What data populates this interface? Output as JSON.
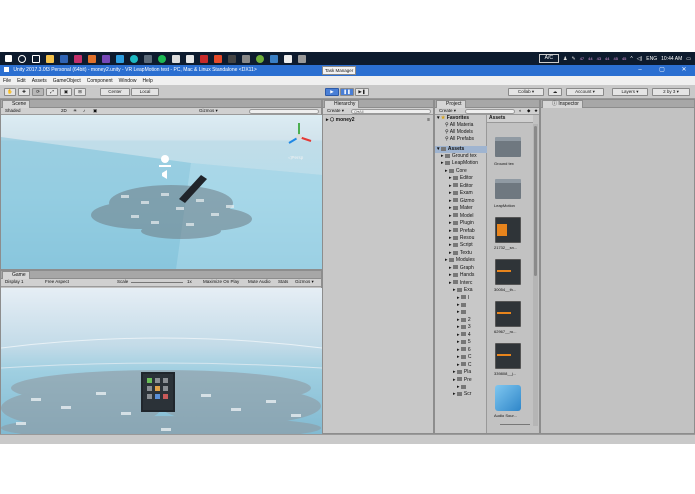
{
  "taskbar": {
    "tooltip": "Task Manager",
    "ac_label": "A/C",
    "tray_numbers": [
      "47",
      "44",
      "43",
      "44",
      "45",
      "45"
    ],
    "language": "ENG",
    "time": "10:44 AM"
  },
  "window": {
    "title": "Unity 2017.3.0f3 Personal (64bit) - money2.unity - VR LeapMotion test - PC, Mac & Linux Standalone <DX11>",
    "minimize": "–",
    "maximize": "▢",
    "close": "✕"
  },
  "menu": [
    "File",
    "Edit",
    "Assets",
    "GameObject",
    "Component",
    "Window",
    "Help"
  ],
  "toolbar": {
    "center": "Center",
    "local": "Local",
    "collab": "Collab ▾",
    "account": "Account ▾",
    "layers": "Layers ▾",
    "layout": "2 by 3 ▾"
  },
  "scene": {
    "tab": "Scene",
    "shading": "Shaded",
    "mode_2d": "2D",
    "gizmos": "Gizmos ▾",
    "persp": "◁Persp"
  },
  "game": {
    "tab": "Game",
    "display": "Display 1",
    "aspect": "Free Aspect",
    "scale_label": "Scale",
    "scale_value": "1x",
    "maximize": "Maximize On Play",
    "mute": "Mute Audio",
    "stats": "Stats",
    "gizmos": "Gizmos ▾"
  },
  "hierarchy": {
    "tab": "Hierarchy",
    "create": "Create ▾",
    "search_placeholder": "Q▾All",
    "root": "money2"
  },
  "project": {
    "tab": "Project",
    "create": "Create ▾",
    "favorites": "Favorites",
    "fav_items": [
      "All Materia",
      "All Models",
      "All Prefabs"
    ],
    "assets_root": "Assets",
    "breadcrumb": "Assets",
    "tree": [
      {
        "label": "Ground tex",
        "indent": 1
      },
      {
        "label": "LeapMotion",
        "indent": 1
      },
      {
        "label": "Core",
        "indent": 2
      },
      {
        "label": "Editor",
        "indent": 3
      },
      {
        "label": "Editor",
        "indent": 3
      },
      {
        "label": "Exam",
        "indent": 3
      },
      {
        "label": "Gizmo",
        "indent": 3
      },
      {
        "label": "Mater",
        "indent": 3
      },
      {
        "label": "Model",
        "indent": 3
      },
      {
        "label": "Plugin",
        "indent": 3
      },
      {
        "label": "Prefab",
        "indent": 3
      },
      {
        "label": "Resou",
        "indent": 3
      },
      {
        "label": "Script",
        "indent": 3
      },
      {
        "label": "Textu",
        "indent": 3
      },
      {
        "label": "Modules",
        "indent": 2
      },
      {
        "label": "Graph",
        "indent": 3
      },
      {
        "label": "Hands",
        "indent": 3
      },
      {
        "label": "Interc",
        "indent": 3
      },
      {
        "label": "Exa",
        "indent": 4
      },
      {
        "label": "I",
        "indent": 5
      },
      {
        "label": "",
        "indent": 5
      },
      {
        "label": "",
        "indent": 5
      },
      {
        "label": "2",
        "indent": 5
      },
      {
        "label": "3",
        "indent": 5
      },
      {
        "label": "4",
        "indent": 5
      },
      {
        "label": "5",
        "indent": 5
      },
      {
        "label": "6",
        "indent": 5
      },
      {
        "label": "C",
        "indent": 5
      },
      {
        "label": "C",
        "indent": 5
      },
      {
        "label": "Pla",
        "indent": 4
      },
      {
        "label": "Pre",
        "indent": 4
      },
      {
        "label": "",
        "indent": 5
      },
      {
        "label": "Scr",
        "indent": 4
      }
    ],
    "assets": [
      {
        "label": "Ground tex",
        "kind": "folder"
      },
      {
        "label": "LeapMotion",
        "kind": "folder"
      },
      {
        "label": "21732__sn...",
        "kind": "audio"
      },
      {
        "label": "30054__th...",
        "kind": "audio"
      },
      {
        "label": "62967__ro...",
        "kind": "audio"
      },
      {
        "label": "339808__j...",
        "kind": "audio"
      },
      {
        "label": "Audio Sour...",
        "kind": "cube"
      }
    ]
  },
  "inspector": {
    "tab": "Inspector"
  }
}
